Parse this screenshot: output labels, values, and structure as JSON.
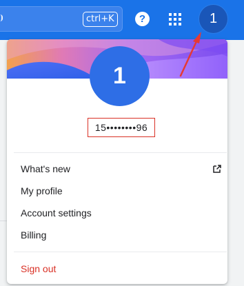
{
  "header": {
    "search_shortcut": "ctrl+K",
    "help_glyph": "?",
    "avatar_initial": "1"
  },
  "account_menu": {
    "avatar_initial": "1",
    "account_id": "15••••••••96",
    "items": [
      {
        "label": "What's new",
        "icon": "open-in-new-icon"
      },
      {
        "label": "My profile"
      },
      {
        "label": "Account settings"
      },
      {
        "label": "Billing"
      }
    ],
    "sign_out_label": "Sign out"
  },
  "colors": {
    "header_blue": "#1a73e8",
    "avatar_blue": "#2e6ee6",
    "sign_out_red": "#d93025",
    "highlight_box_red": "#d93025"
  }
}
